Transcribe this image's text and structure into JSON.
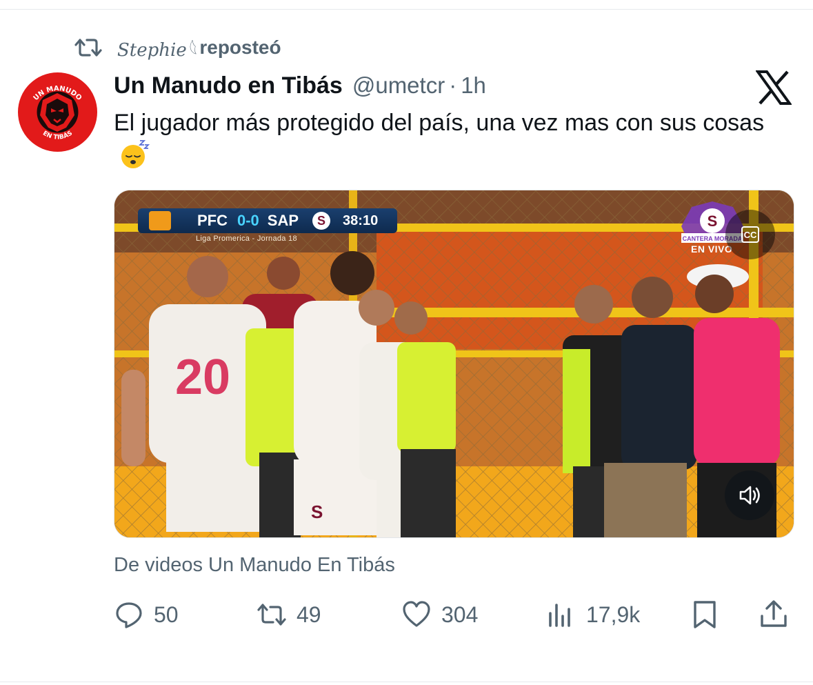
{
  "repost": {
    "reposter_name": "Stephie𓆩",
    "label": "reposteó",
    "icon": "repost-icon"
  },
  "tweet": {
    "author_name": "Un Manudo en Tibás",
    "handle": "@umetcr",
    "separator": "·",
    "time": "1h",
    "text_line": "El jugador más protegido del país, una vez mas con sus cosas",
    "emoji": "sleeping-face-emoji",
    "avatar_top_text": "UN MANUDO",
    "avatar_bottom_text": "EN TIBÁS"
  },
  "media": {
    "scoreboard": {
      "home": "PFC",
      "score": "0-0",
      "away": "SAP",
      "away_badge": "S",
      "clock": "38:10",
      "league": "Liga Promerica - Jornada 18"
    },
    "live_badge": {
      "top_text": "S",
      "banner": "CANTERA MORADA",
      "label": "EN VIVO"
    },
    "player_number": "20",
    "cc_label": "CC",
    "volume_icon": "speaker-icon"
  },
  "source_line": "De videos Un Manudo En Tibás",
  "actions": {
    "replies": "50",
    "reposts": "49",
    "likes": "304",
    "views": "17,9k"
  },
  "colors": {
    "text_primary": "#0f1419",
    "text_secondary": "#536471",
    "avatar_red": "#e21a1a",
    "pink_shirt": "#ef2f6e"
  }
}
